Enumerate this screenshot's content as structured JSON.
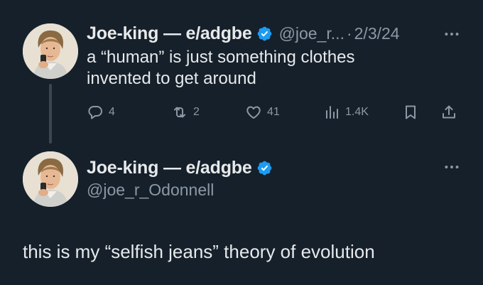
{
  "reply_tweet": {
    "display_name": "Joe-king — e/adgbe",
    "handle": "@joe_r...",
    "separator": "·",
    "date": "2/3/24",
    "text_line1": "a “human” is just something clothes",
    "text_line2": "invented to get around",
    "actions": {
      "replies": "4",
      "reposts": "2",
      "likes": "41",
      "views": "1.4K"
    }
  },
  "main_tweet": {
    "display_name": "Joe-king — e/adgbe",
    "handle": "@joe_r_Odonnell",
    "text": "this is my “selfish jeans” theory of evolution"
  },
  "colors": {
    "background": "#15202b",
    "text": "#e7e9ea",
    "muted": "#8b98a5",
    "verified": "#1d9bf0",
    "thread_line": "#3b4651"
  },
  "icons": {
    "reply": "reply-icon",
    "repost": "repost-icon",
    "like": "heart-icon",
    "views": "bar-chart-icon",
    "bookmark": "bookmark-icon",
    "share": "share-icon",
    "verified": "verified-badge-icon",
    "more": "more-dots-icon"
  }
}
